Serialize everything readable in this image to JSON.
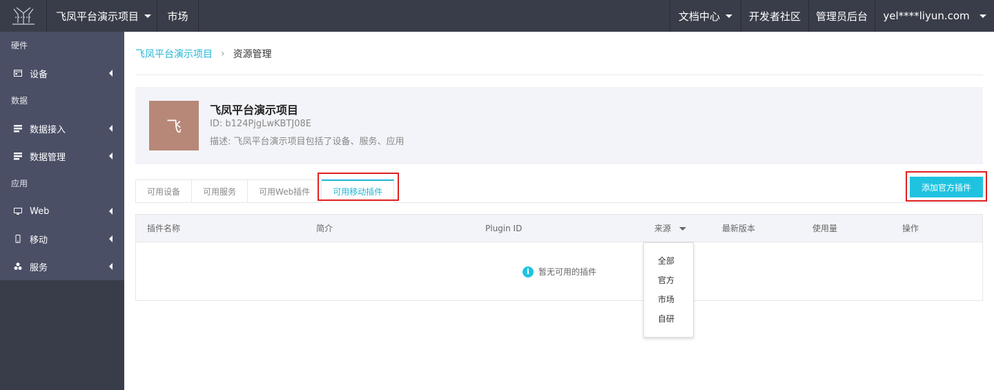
{
  "topbar": {
    "project_menu": "飞凤平台演示项目",
    "market": "市场",
    "docs_center": "文档中心",
    "dev_community": "开发者社区",
    "admin_console": "管理员后台",
    "user_account": "yel****liyun.com"
  },
  "sidebar": {
    "groups": [
      {
        "label": "硬件",
        "items": [
          {
            "label": "设备",
            "icon": "device-icon"
          }
        ]
      },
      {
        "label": "数据",
        "items": [
          {
            "label": "数据接入",
            "icon": "data-icon"
          },
          {
            "label": "数据管理",
            "icon": "data-icon"
          }
        ]
      },
      {
        "label": "应用",
        "items": [
          {
            "label": "Web",
            "icon": "monitor-icon"
          },
          {
            "label": "移动",
            "icon": "mobile-icon"
          },
          {
            "label": "服务",
            "icon": "cluster-icon"
          }
        ]
      }
    ]
  },
  "breadcrumb": {
    "project": "飞凤平台演示项目",
    "separator": "›",
    "current": "资源管理"
  },
  "project": {
    "avatar_char": "飞",
    "name": "飞凤平台演示项目",
    "id_text": "ID: b124PjgLwKBTJ08E",
    "description": "描述: 飞凤平台演示项目包括了设备、服务、应用"
  },
  "tabs": [
    {
      "label": "可用设备",
      "active": false
    },
    {
      "label": "可用服务",
      "active": false
    },
    {
      "label": "可用Web插件",
      "active": false
    },
    {
      "label": "可用移动插件",
      "active": true
    }
  ],
  "add_button": "添加官方插件",
  "table": {
    "columns": [
      "插件名称",
      "简介",
      "Plugin ID",
      "来源",
      "最新版本",
      "使用量",
      "操作"
    ],
    "empty_text": "暂无可用的插件"
  },
  "source_filter": {
    "options": [
      "全部",
      "官方",
      "市场",
      "自研"
    ]
  },
  "colors": {
    "accent": "#1fb6d4",
    "button": "#1fc3e0",
    "topbar": "#393d49",
    "sidebar_active": "#4a4f66",
    "avatar": "#b78878",
    "highlight": "#e02020"
  }
}
